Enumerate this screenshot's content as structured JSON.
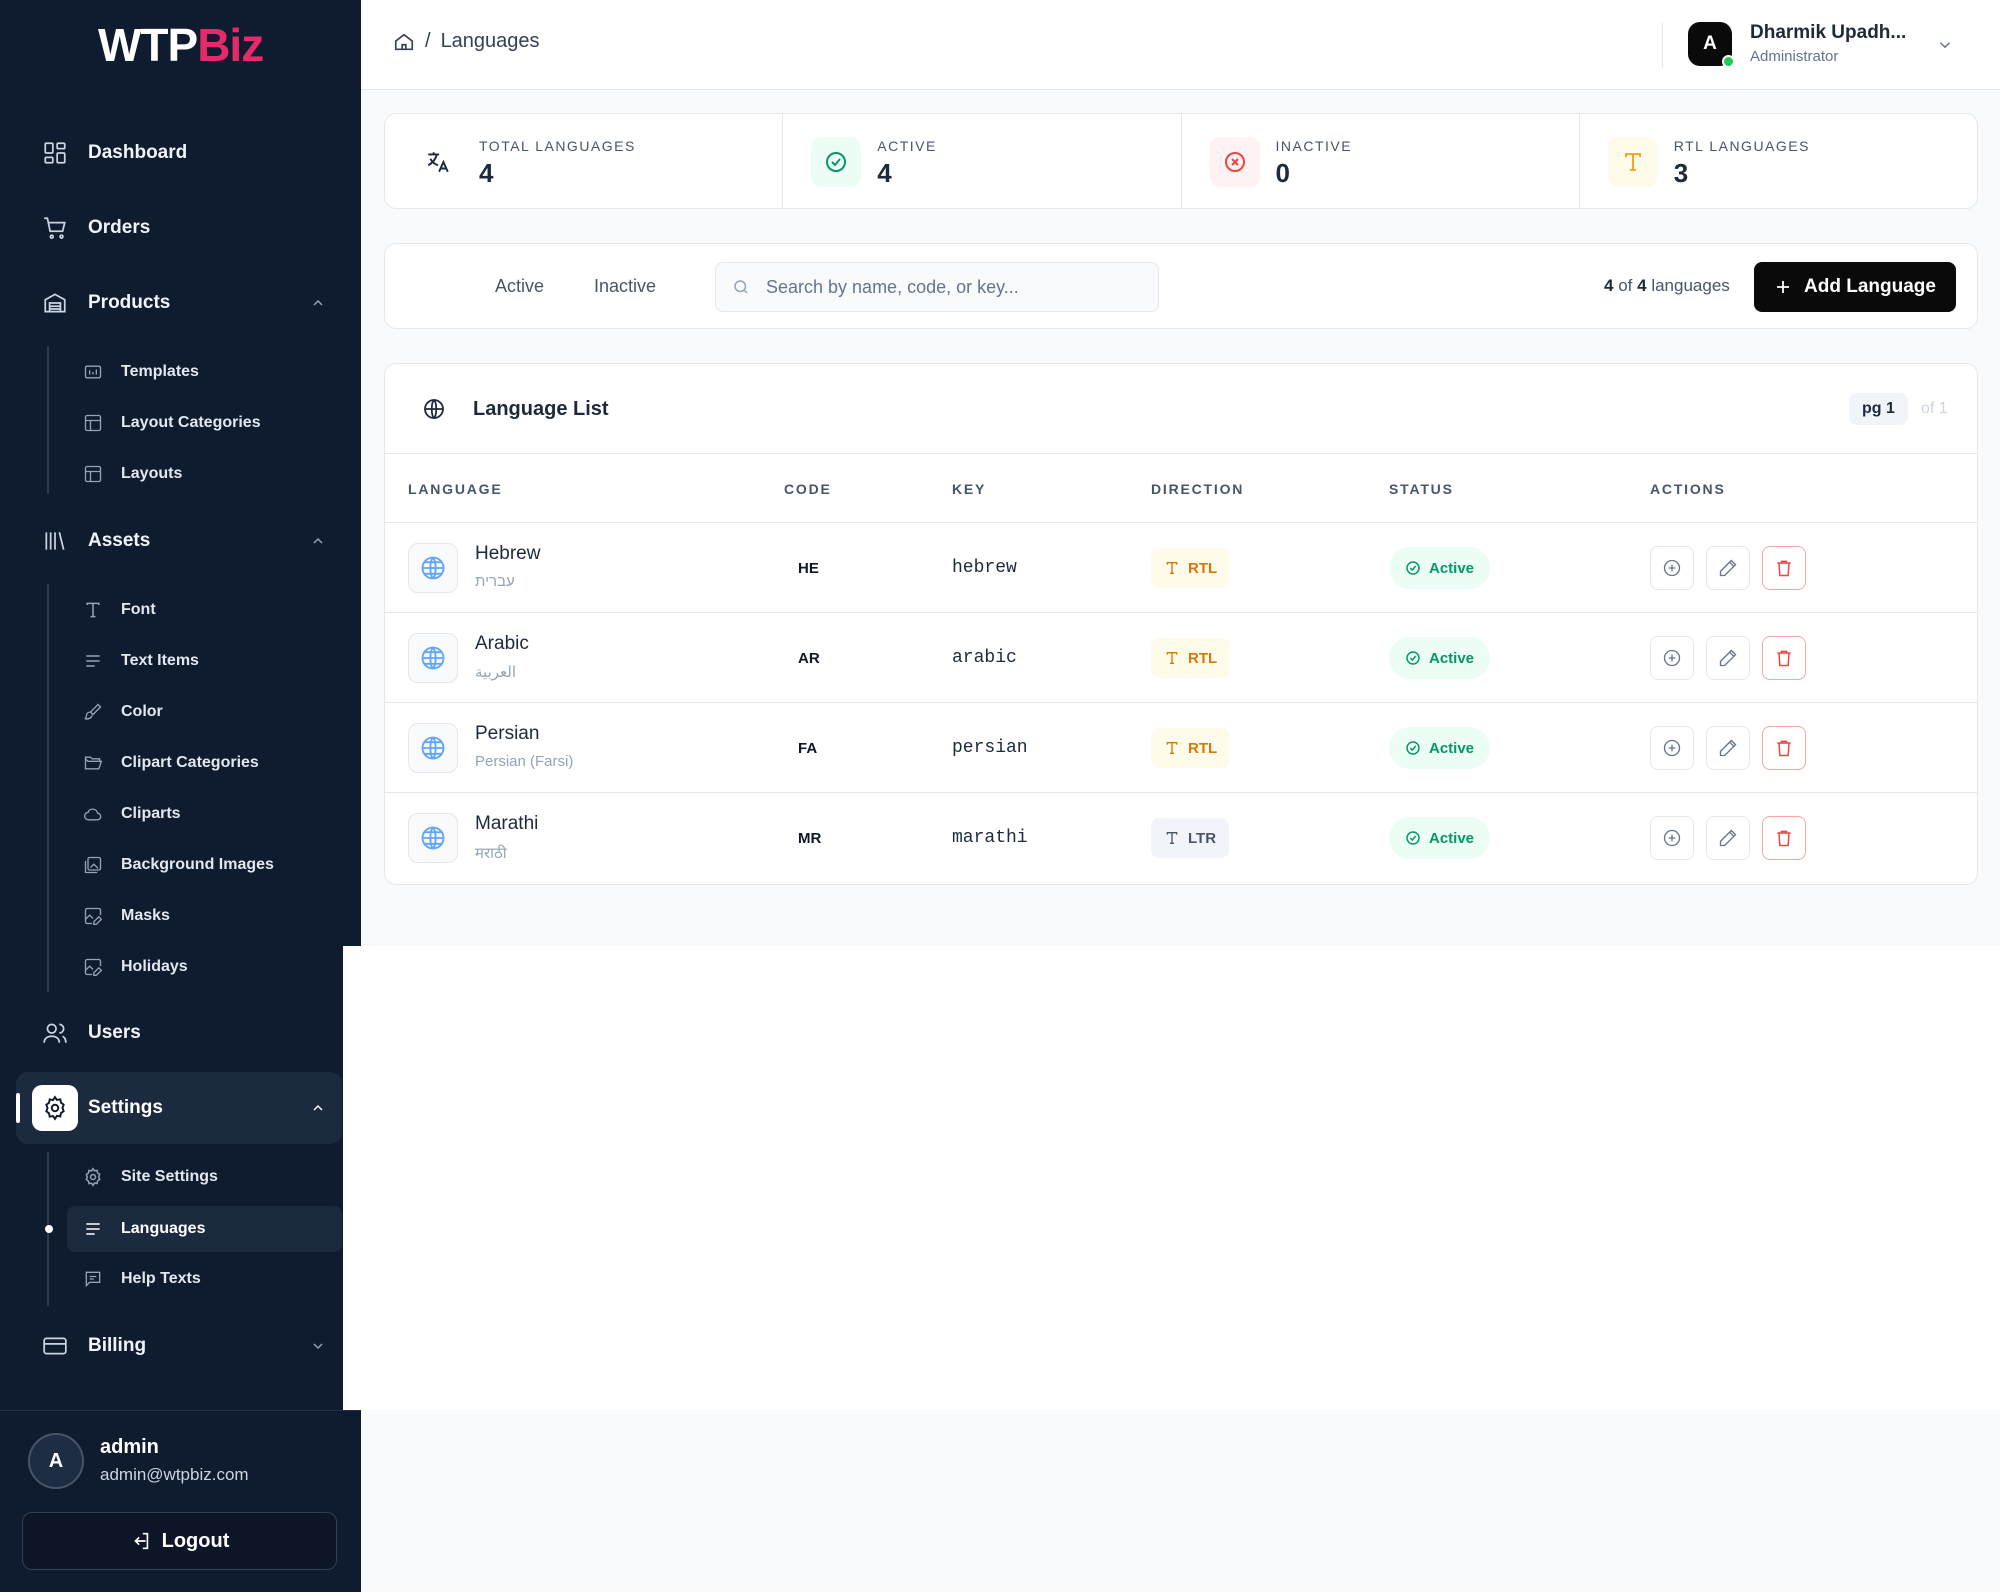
{
  "brand": {
    "logo_part1": "WTP",
    "logo_part2": "Biz"
  },
  "sidebar": {
    "nav": {
      "dashboard": "Dashboard",
      "orders": "Orders",
      "products": "Products",
      "assets": "Assets",
      "users": "Users",
      "settings": "Settings",
      "billing": "Billing"
    },
    "products_sub": [
      "Templates",
      "Layout Categories",
      "Layouts"
    ],
    "assets_sub": [
      "Font",
      "Text Items",
      "Color",
      "Clipart Categories",
      "Cliparts",
      "Background Images",
      "Masks",
      "Holidays"
    ],
    "settings_sub": [
      "Site Settings",
      "Languages",
      "Help Texts"
    ],
    "user": {
      "avatar": "A",
      "name": "admin",
      "email": "admin@wtpbiz.com"
    },
    "logout": "Logout"
  },
  "topbar": {
    "breadcrumb_sep": "/",
    "breadcrumb_current": "Languages",
    "user_avatar": "A",
    "user_name": "Dharmik Upadh...",
    "user_role": "Administrator"
  },
  "stats": [
    {
      "label": "TOTAL LANGUAGES",
      "value": "4",
      "icon": "translate-icon"
    },
    {
      "label": "ACTIVE",
      "value": "4",
      "icon": "check-circle-icon"
    },
    {
      "label": "INACTIVE",
      "value": "0",
      "icon": "x-circle-icon"
    },
    {
      "label": "RTL LANGUAGES",
      "value": "3",
      "icon": "type-icon"
    }
  ],
  "filters": {
    "tab_active": "Active",
    "tab_inactive": "Inactive",
    "search_placeholder": "Search by name, code, or key...",
    "count_shown": "4",
    "count_of": "of",
    "count_total": "4",
    "count_suffix": "languages",
    "add_button": "Add Language"
  },
  "list": {
    "title": "Language List",
    "page": "pg 1",
    "page_of": "of 1",
    "columns": [
      "LANGUAGE",
      "CODE",
      "KEY",
      "DIRECTION",
      "STATUS",
      "ACTIONS"
    ],
    "rows": [
      {
        "name": "Hebrew",
        "native": "עברית",
        "code": "HE",
        "key": "hebrew",
        "direction": "RTL",
        "status": "Active"
      },
      {
        "name": "Arabic",
        "native": "العربية",
        "code": "AR",
        "key": "arabic",
        "direction": "RTL",
        "status": "Active"
      },
      {
        "name": "Persian",
        "native": "Persian (Farsi)",
        "code": "FA",
        "key": "persian",
        "direction": "RTL",
        "status": "Active"
      },
      {
        "name": "Marathi",
        "native": "मराठी",
        "code": "MR",
        "key": "marathi",
        "direction": "LTR",
        "status": "Active"
      }
    ]
  },
  "colors": {
    "sidebar_bg": "#0f1b2e",
    "brand_accent": "#e6296b",
    "active_green": "#059669",
    "rtl_amber": "#d97706",
    "danger_red": "#ef4444",
    "primary_button": "#0a0a0a"
  }
}
